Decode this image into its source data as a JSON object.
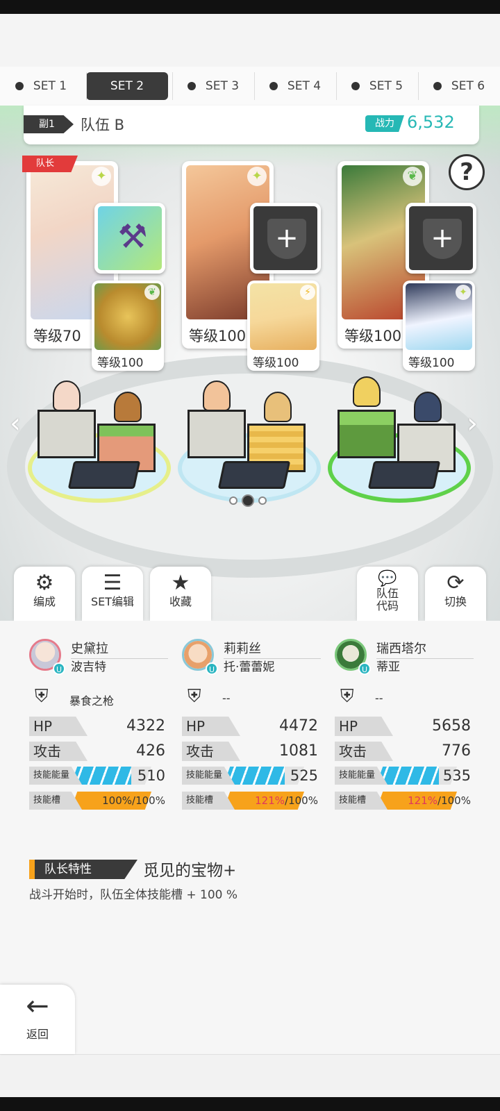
{
  "set_tabs": [
    "SET 1",
    "SET 2",
    "SET 3",
    "SET 4",
    "SET 5",
    "SET 6"
  ],
  "active_set": "SET 2",
  "team": {
    "sub_label": "副1",
    "name": "队伍 B",
    "power_label": "战力",
    "power_value": "6,532"
  },
  "leader_tag": "队长",
  "help_label": "?",
  "heroes": [
    {
      "level": "等级70",
      "sub_level": "等级100",
      "name": "史黛拉",
      "title": "波吉特",
      "weapon": "暴食之枪",
      "hp": "4322",
      "atk": "426",
      "skill_energy": "510",
      "skill_slot_cur": "100",
      "skill_slot_max": "100"
    },
    {
      "level": "等级100",
      "sub_level": "等级100",
      "name": "莉莉丝",
      "title": "托·蕾蕾妮",
      "weapon": "--",
      "hp": "4472",
      "atk": "1081",
      "skill_energy": "525",
      "skill_slot_cur": "121",
      "skill_slot_max": "100"
    },
    {
      "level": "等级100",
      "sub_level": "等级100",
      "name": "瑞西塔尔",
      "title": "蒂亚",
      "weapon": "--",
      "hp": "5658",
      "atk": "776",
      "skill_energy": "535",
      "skill_slot_cur": "121",
      "skill_slot_max": "100"
    }
  ],
  "stat_labels": {
    "hp": "HP",
    "atk": "攻击",
    "skill_energy": "技能能量",
    "skill_slot": "技能槽",
    "percent": "%",
    "slash": "/"
  },
  "actions": {
    "formation": "编成",
    "set_edit": "SET编辑",
    "favorite": "收藏",
    "team_code_1": "队伍",
    "team_code_2": "代码",
    "switch": "切换"
  },
  "leader_skill": {
    "tag": "队长特性",
    "name": "觅见的宝物+",
    "desc": "战斗开始时，队伍全体技能槽 + 100 %"
  },
  "back_label": "返回",
  "progress": {
    "energy_fraction": [
      0.75,
      0.76,
      0.78
    ],
    "slot_fraction": [
      1.0,
      1.0,
      1.0
    ]
  }
}
